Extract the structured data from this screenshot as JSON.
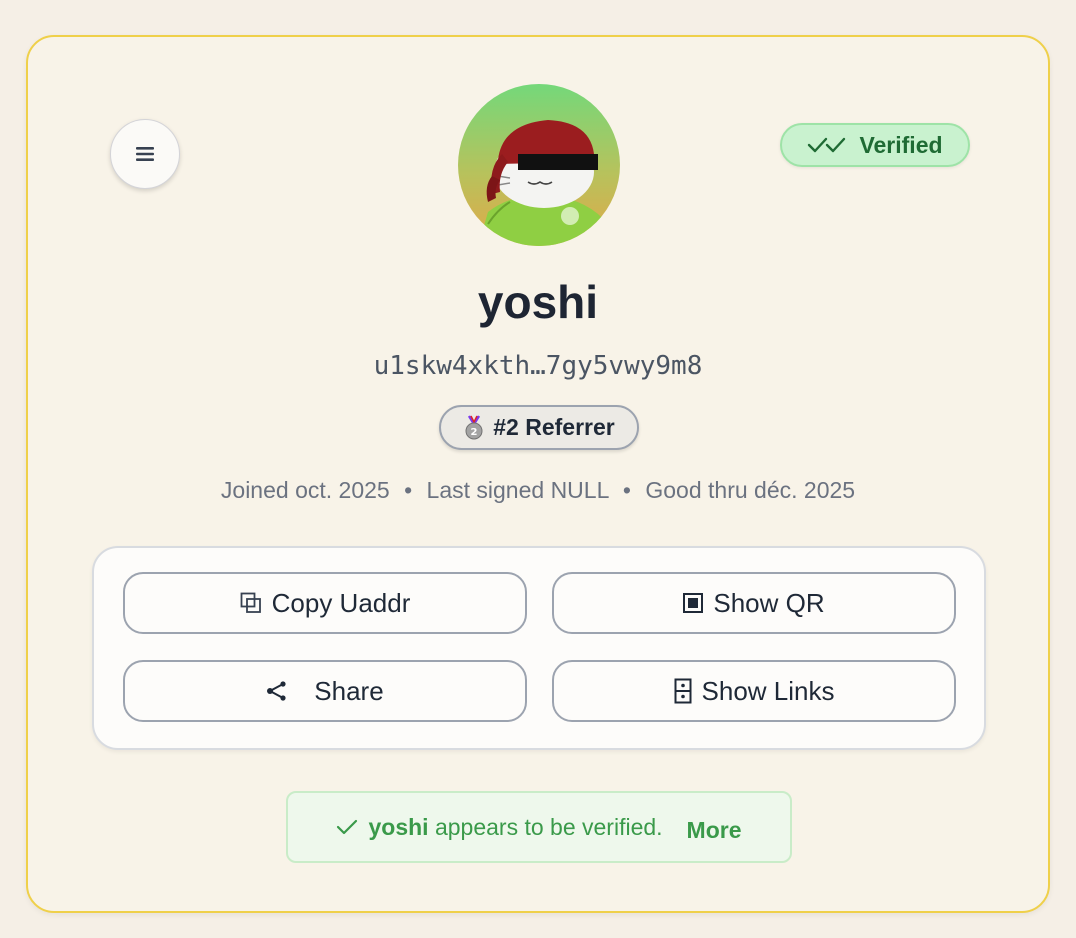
{
  "header": {
    "menu_icon": "hamburger-menu-icon",
    "verified_badge": {
      "icon": "double-check-icon",
      "label": "Verified",
      "color": "#1f6b34",
      "background": "#c9f2cf"
    }
  },
  "profile": {
    "avatar_icon": "profile-avatar",
    "username": "yoshi",
    "uaddr": "u1skw4xkth…7gy5vwy9m8",
    "referrer_badge": {
      "icon": "silver-medal-icon",
      "label": "#2 Referrer"
    },
    "meta": {
      "joined": "Joined oct. 2025",
      "last_signed": "Last signed NULL",
      "good_thru": "Good thru déc. 2025",
      "separator": "•"
    }
  },
  "actions": {
    "copy": {
      "label": "Copy Uaddr",
      "icon": "copy-icon"
    },
    "qr": {
      "label": "Show QR",
      "icon": "qr-square-icon"
    },
    "share": {
      "label": "Share",
      "icon": "share-icon"
    },
    "links": {
      "label": "Show Links",
      "icon": "links-icon"
    }
  },
  "notice": {
    "icon": "check-icon",
    "name": "yoshi",
    "text": "appears to be verified.",
    "more_label": "More",
    "color": "#3a9a4a"
  },
  "colors": {
    "page_background": "#f5efe6",
    "card_background": "#f8f3e8",
    "card_border": "#efd04a"
  }
}
